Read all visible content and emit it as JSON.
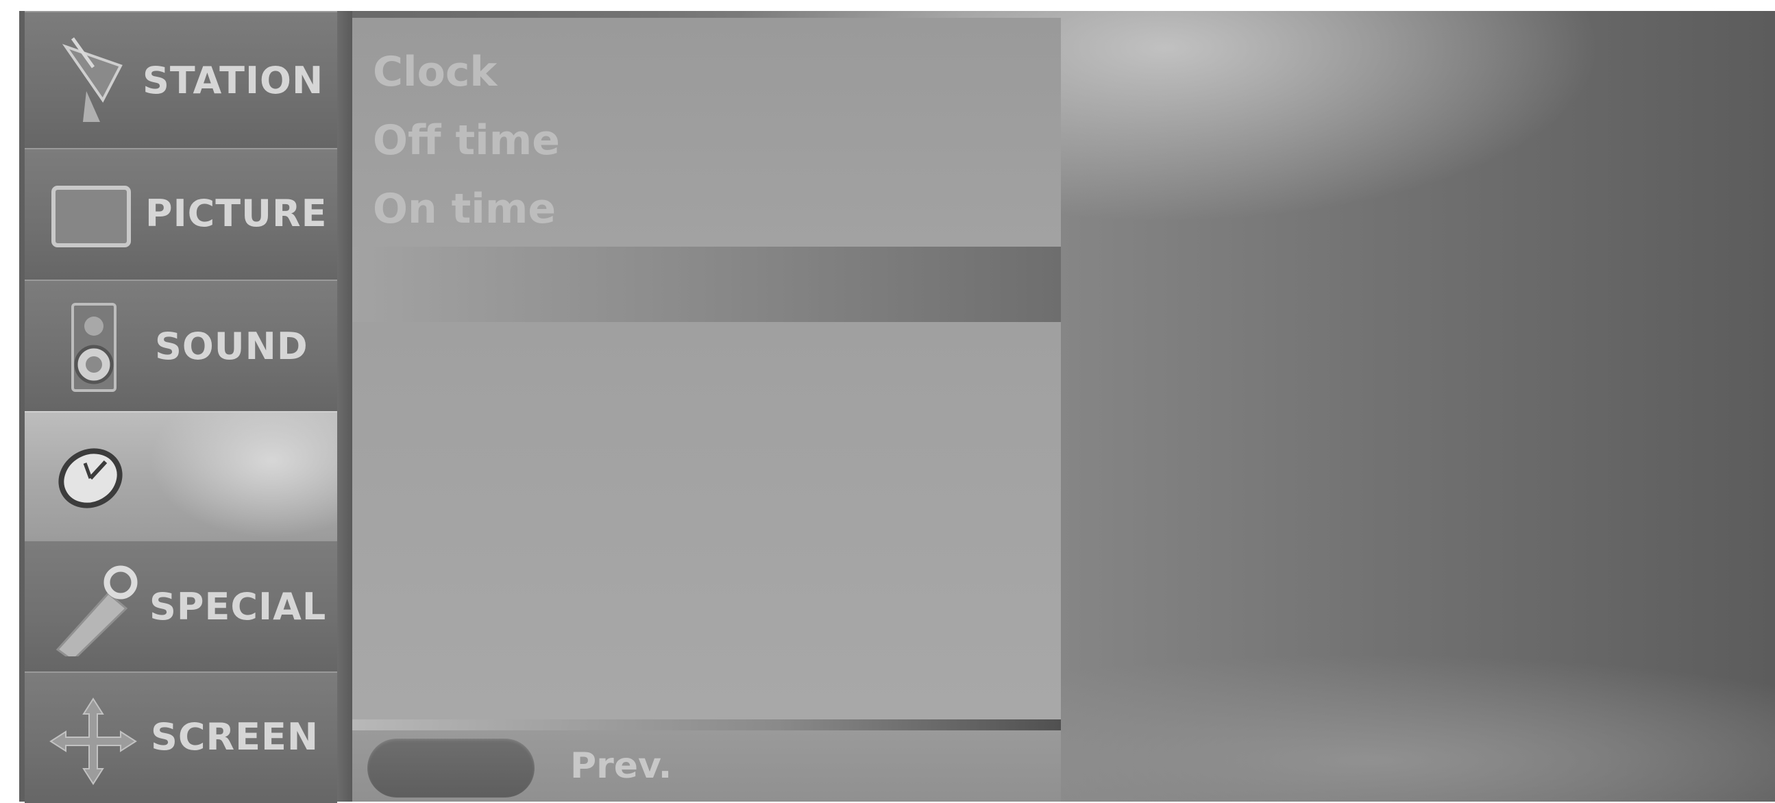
{
  "menu": {
    "categories": [
      {
        "label": "STATION",
        "icon": "satellite-dish-icon"
      },
      {
        "label": "PICTURE",
        "icon": "tv-screen-icon"
      },
      {
        "label": "SOUND",
        "icon": "speaker-icon"
      },
      {
        "label": "",
        "icon": "clock-icon",
        "selected": true
      },
      {
        "label": "SPECIAL",
        "icon": "key-tag-icon"
      },
      {
        "label": "SCREEN",
        "icon": "move-arrows-icon"
      }
    ]
  },
  "submenu": {
    "items": [
      "Clock",
      "Off time",
      "On time"
    ]
  },
  "footer": {
    "prev_label": "Prev."
  }
}
